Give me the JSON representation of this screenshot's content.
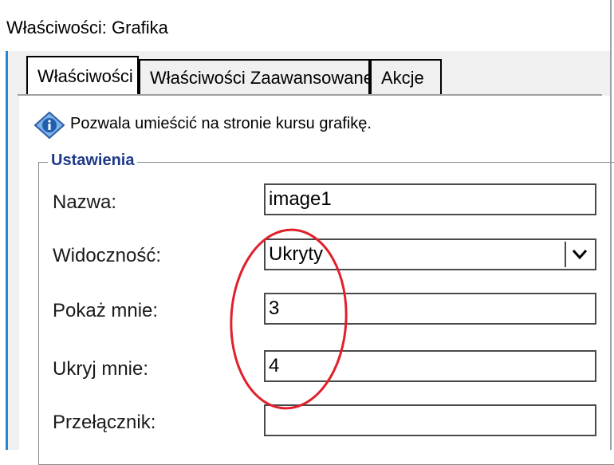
{
  "window": {
    "title": "Właściwości: Grafika"
  },
  "tabs": [
    {
      "label": "Właściwości",
      "active": true
    },
    {
      "label": "Właściwości Zaawansowane",
      "active": false
    },
    {
      "label": "Akcje",
      "active": false
    }
  ],
  "info": {
    "icon": "info-diamond-icon",
    "text": "Pozwala umieścić na stronie kursu grafikę."
  },
  "settings": {
    "group_label": "Ustawienia",
    "fields": [
      {
        "label": "Nazwa:",
        "value": "image1",
        "type": "text"
      },
      {
        "label": "Widoczność:",
        "value": "Ukryty",
        "type": "select"
      },
      {
        "label": "Pokaż mnie:",
        "value": "3",
        "type": "text"
      },
      {
        "label": "Ukryj mnie:",
        "value": "4",
        "type": "text"
      },
      {
        "label": "Przełącznik:",
        "value": "",
        "type": "text"
      }
    ]
  },
  "colors": {
    "accent": "#1e88d8",
    "annotation": "#e0202a",
    "group_label": "#1d3a8a"
  }
}
